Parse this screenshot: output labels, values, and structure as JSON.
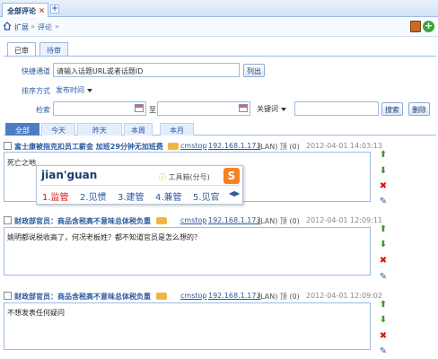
{
  "tab": {
    "label": "全部评论",
    "close": "×",
    "add": "+"
  },
  "breadcrumb": {
    "items": [
      "扩展",
      "评论"
    ],
    "sep": "»"
  },
  "filter_tabs": [
    "已审",
    "待审"
  ],
  "quick": {
    "label": "快捷通道",
    "placeholder": "请输入话题URL或者话题ID",
    "button": "列出"
  },
  "sort": {
    "label": "排序方式",
    "value": "发布时间"
  },
  "search": {
    "label": "检索",
    "to": "至",
    "keyword": "关键词",
    "search_btn": "搜索",
    "delete_btn": "删除"
  },
  "date_tabs": [
    "全部",
    "今天",
    "昨天",
    "本周",
    "本月"
  ],
  "ime": {
    "composition": "jian'guan",
    "toolbox": "工具箱(分号)",
    "candidates": [
      "1.监管",
      "2.见惯",
      "3.建管",
      "4.兼管",
      "5.见官"
    ],
    "logo": "S",
    "nav": "◀▶"
  },
  "comments": [
    {
      "title": "富士康被指克扣员工薪金 加班29分钟无加班费",
      "user": "cmstop",
      "ip": "192.168.1.173",
      "lan": "(LAN) 顶 (0)",
      "time": "2012-04-01 14:03:13",
      "text": "死亡之地"
    },
    {
      "title": "财政部官员：商品含税高不意味总体税负重",
      "user": "cmstop",
      "ip": "192.168.1.173",
      "lan": "(LAN) 顶 (0)",
      "time": "2012-04-01 12:09:11",
      "text": "姚明都说税收高了，何况老板姓？都不知道官员是怎么想的？"
    },
    {
      "title": "财政部官员：商品含税高不意味总体税负重",
      "user": "cmstop",
      "ip": "192.168.1.173",
      "lan": "(LAN) 顶 (0)",
      "time": "2012-04-01 12:09:02",
      "text": "不想发表任何疑问"
    }
  ],
  "actions": {
    "up": "⬆",
    "down": "⬇",
    "delete": "✖",
    "edit": "✎"
  }
}
